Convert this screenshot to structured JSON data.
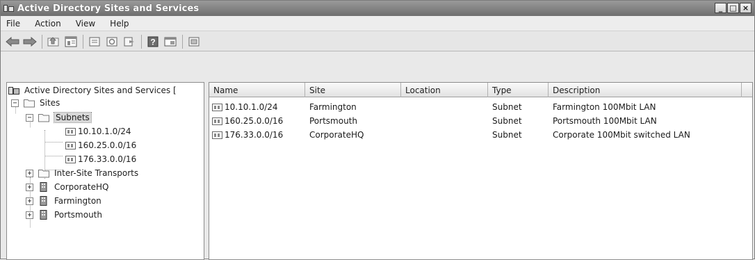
{
  "window": {
    "title": "Active Directory Sites and Services",
    "controls": [
      "_",
      "□",
      "×"
    ]
  },
  "menu": [
    "File",
    "Action",
    "View",
    "Help"
  ],
  "toolbar": {
    "buttons": [
      "back-arrow-icon",
      "forward-arrow-icon",
      "up-folder-icon",
      "show-tree-icon",
      "properties-icon",
      "refresh-icon",
      "export-list-icon",
      "help-icon",
      "console-tree-icon",
      "new-window-icon"
    ]
  },
  "tree": {
    "root": "Active Directory Sites and Services [",
    "sites": "Sites",
    "subnets": "Subnets",
    "subnet_items": [
      "10.10.1.0/24",
      "160.25.0.0/16",
      "176.33.0.0/16"
    ],
    "others": [
      "Inter-Site Transports",
      "CorporateHQ",
      "Farmington",
      "Portsmouth"
    ]
  },
  "list": {
    "headers": [
      "Name",
      "Site",
      "Location",
      "Type",
      "Description"
    ],
    "rows": [
      {
        "name": "10.10.1.0/24",
        "site": "Farmington",
        "location": "",
        "type": "Subnet",
        "description": "Farmington 100Mbit LAN"
      },
      {
        "name": "160.25.0.0/16",
        "site": "Portsmouth",
        "location": "",
        "type": "Subnet",
        "description": "Portsmouth 100Mbit LAN"
      },
      {
        "name": "176.33.0.0/16",
        "site": "CorporateHQ",
        "location": "",
        "type": "Subnet",
        "description": "Corporate 100Mbit switched LAN"
      }
    ]
  }
}
